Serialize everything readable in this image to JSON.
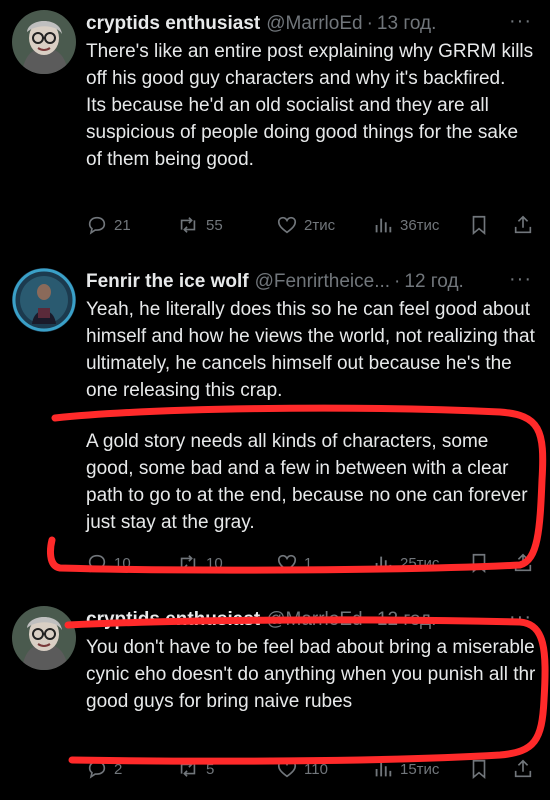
{
  "tweets": [
    {
      "name": "cryptids enthusiast",
      "handle": "@MarrloEd",
      "dot": "·",
      "time": "13 год.",
      "more": "···",
      "text": "There's like an entire post explaining why GRRM kills off his good guy characters and why it's backfired.\nIts because he'd an old socialist and they are all suspicious of people doing good things for the sake of them being good.",
      "replies": "21",
      "reposts": "55",
      "likes": "2тис",
      "views": "36тис"
    },
    {
      "name": "Fenrir the ice wolf",
      "handle": "@Fenrirtheice...",
      "dot": "·",
      "time": "12 год.",
      "more": "···",
      "text": "Yeah, he literally does this so he can feel good about himself and how he views the world, not realizing that ultimately, he cancels himself out because he's the one releasing this crap.",
      "text2": "A gold story needs all kinds of characters, some good, some bad and a few in between with a clear path to go to at the end, because no one can forever just stay at the gray.",
      "replies": "10",
      "reposts": "10",
      "likes": "1",
      "views": "25тис"
    },
    {
      "name": "cryptids enthusiast",
      "handle": "@MarrloEd",
      "dot": "·",
      "time": "12 год.",
      "more": "···",
      "text": "You don't have to be feel bad about bring a miserable cynic eho doesn't do anything when you punish all thr good guys for bring naive rubes",
      "replies": "2",
      "reposts": "5",
      "likes": "110",
      "views": "15тис"
    }
  ],
  "colors": {
    "background": "#000000",
    "text": "#e7e9ea",
    "muted": "#71767b",
    "annotation": "#ff2a2a"
  },
  "icons": [
    "reply-icon",
    "repost-icon",
    "like-icon",
    "views-icon",
    "bookmark-icon",
    "share-icon"
  ]
}
